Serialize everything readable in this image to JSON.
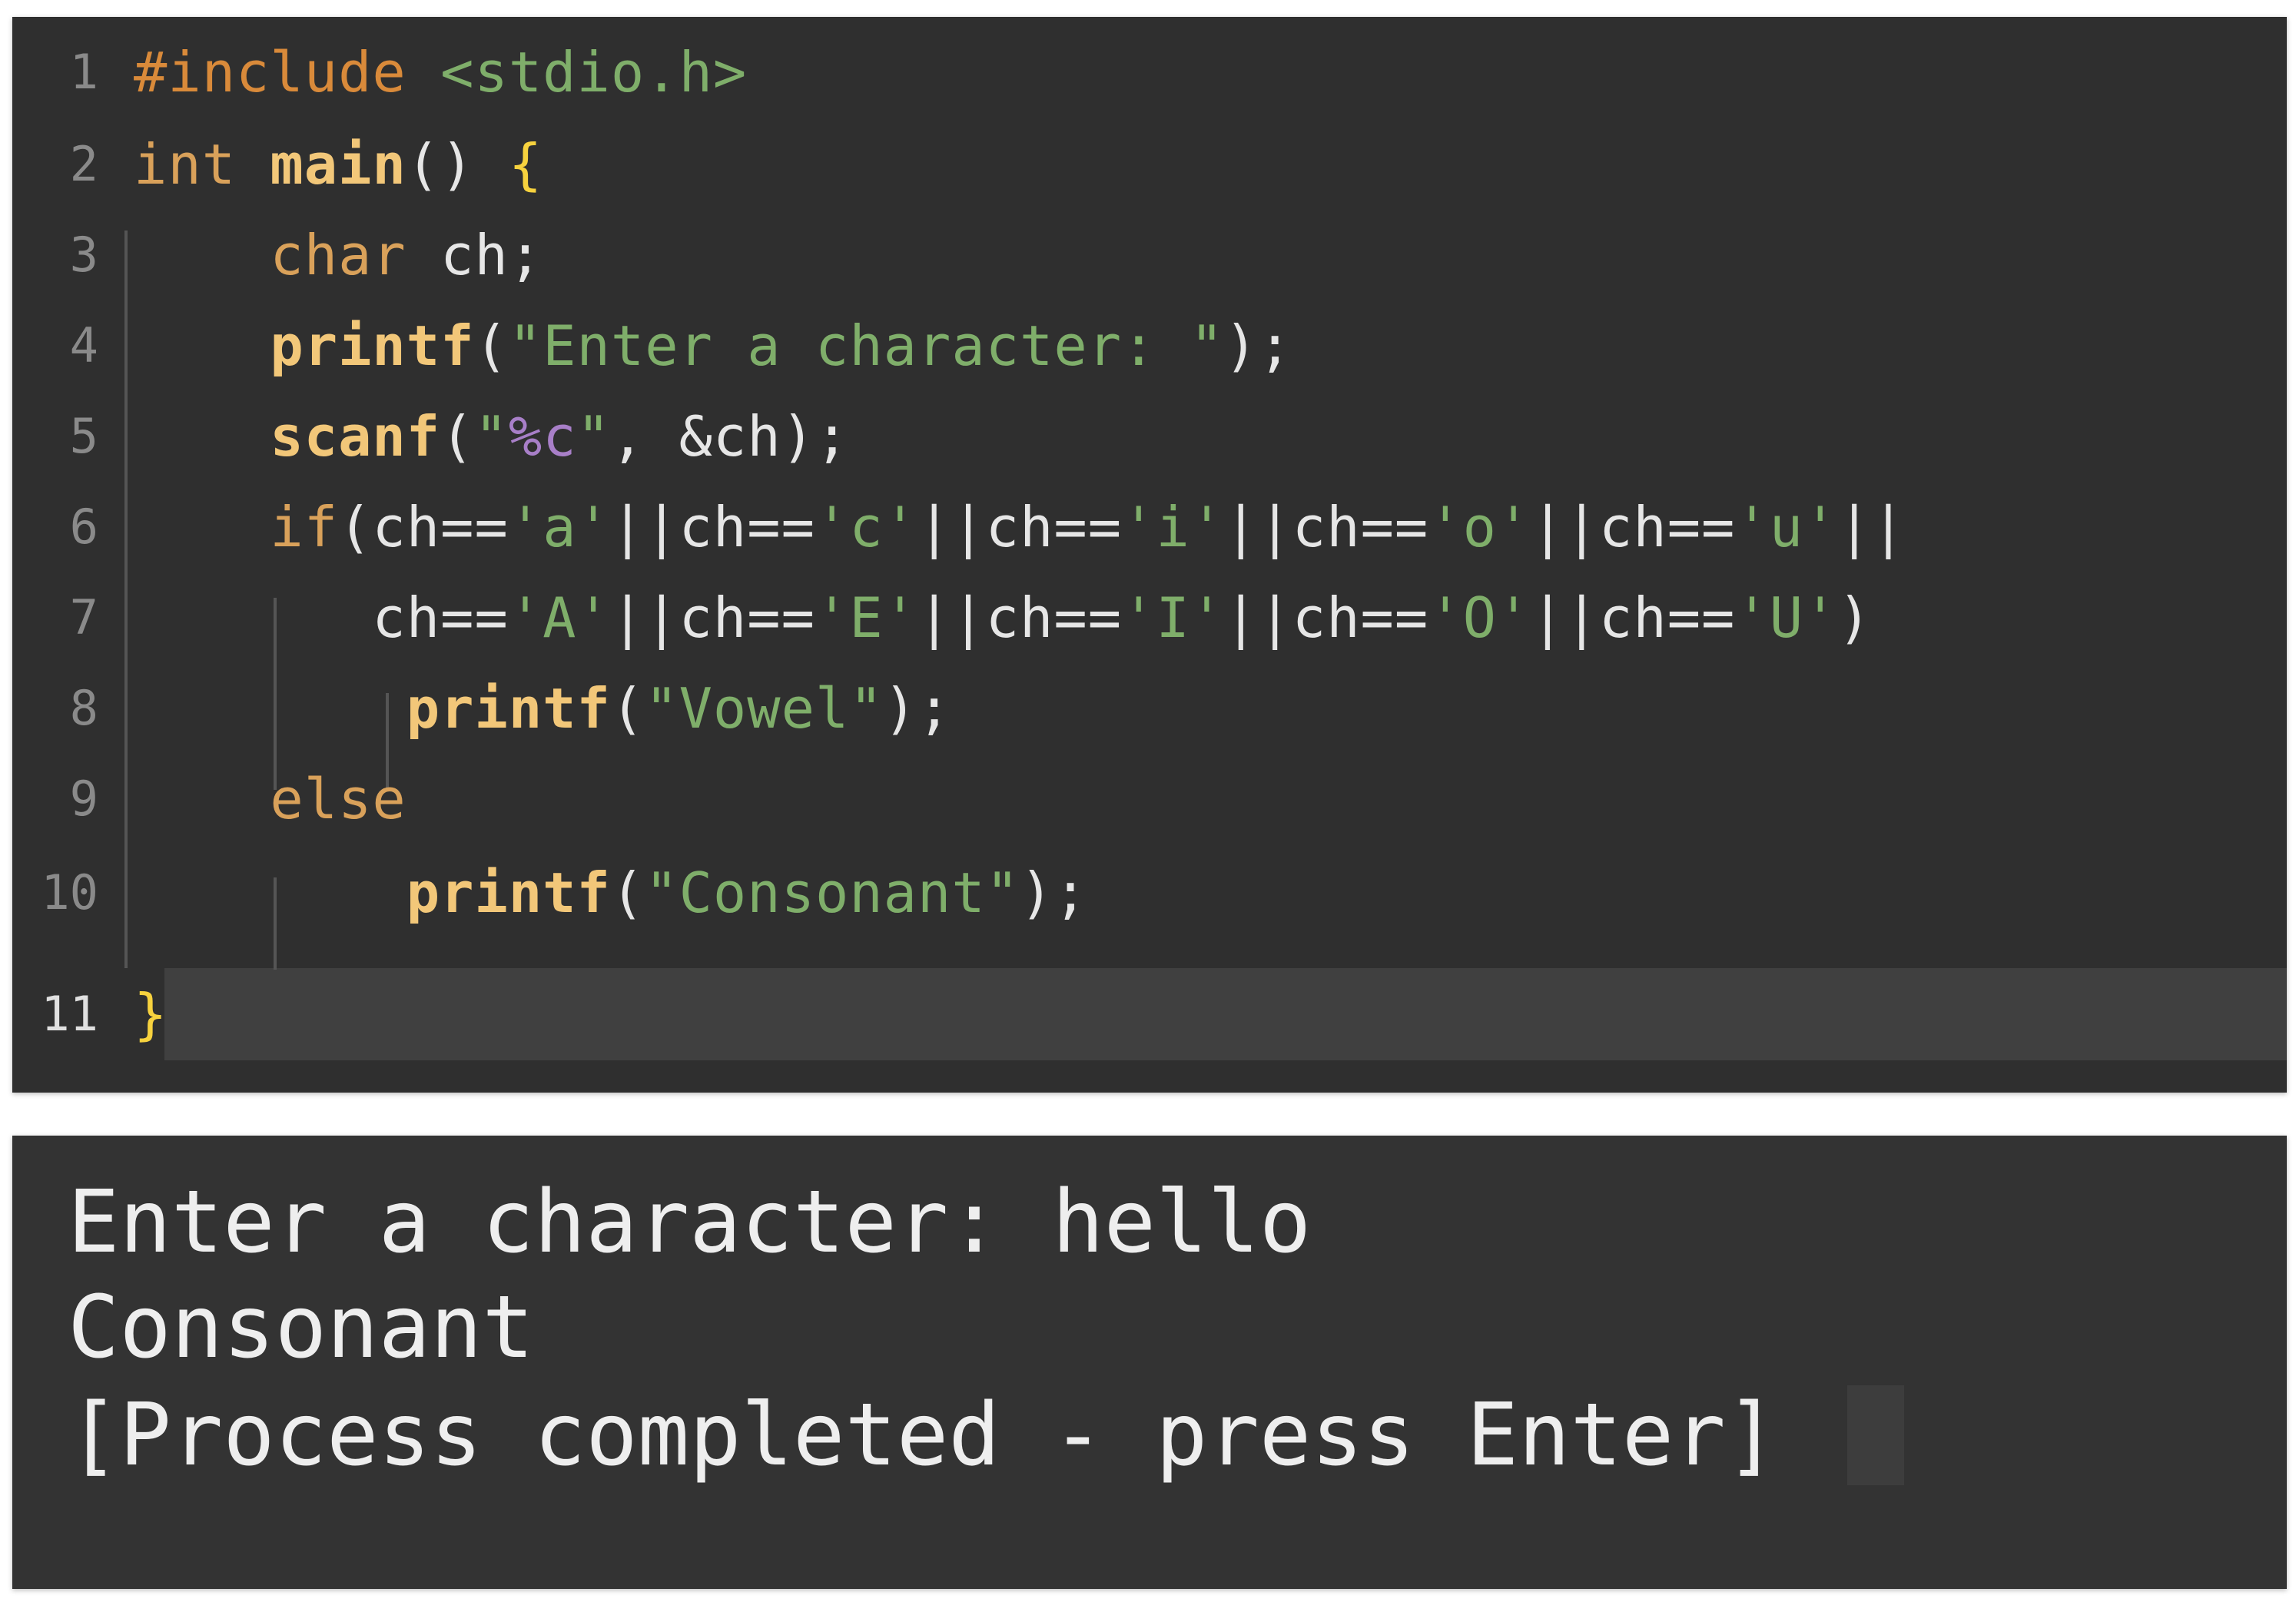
{
  "editor": {
    "line_numbers": [
      "1",
      "2",
      "3",
      "4",
      "5",
      "6",
      "7",
      "8",
      "9",
      "10",
      "11"
    ],
    "lines": [
      [
        {
          "t": "#include",
          "c": "pp"
        },
        {
          "t": " ",
          "c": "plain"
        },
        {
          "t": "<stdio.h>",
          "c": "hdr"
        }
      ],
      [
        {
          "t": "int",
          "c": "kw"
        },
        {
          "t": " ",
          "c": "plain"
        },
        {
          "t": "main",
          "c": "fn"
        },
        {
          "t": "() ",
          "c": "plain"
        },
        {
          "t": "{",
          "c": "brace"
        }
      ],
      [
        {
          "t": "    ",
          "c": "plain"
        },
        {
          "t": "char",
          "c": "kw"
        },
        {
          "t": " ch;",
          "c": "plain"
        }
      ],
      [
        {
          "t": "    ",
          "c": "plain"
        },
        {
          "t": "printf",
          "c": "fn"
        },
        {
          "t": "(",
          "c": "plain"
        },
        {
          "t": "\"Enter a character: \"",
          "c": "str"
        },
        {
          "t": ");",
          "c": "plain"
        }
      ],
      [
        {
          "t": "    ",
          "c": "plain"
        },
        {
          "t": "scanf",
          "c": "fn"
        },
        {
          "t": "(",
          "c": "plain"
        },
        {
          "t": "\"",
          "c": "str"
        },
        {
          "t": "%c",
          "c": "fmt"
        },
        {
          "t": "\"",
          "c": "str"
        },
        {
          "t": ", &ch);",
          "c": "plain"
        }
      ],
      [
        {
          "t": "    ",
          "c": "plain"
        },
        {
          "t": "if",
          "c": "kw"
        },
        {
          "t": "(ch==",
          "c": "plain"
        },
        {
          "t": "'a'",
          "c": "str"
        },
        {
          "t": "||ch==",
          "c": "plain"
        },
        {
          "t": "'c'",
          "c": "str"
        },
        {
          "t": "||ch==",
          "c": "plain"
        },
        {
          "t": "'i'",
          "c": "str"
        },
        {
          "t": "||ch==",
          "c": "plain"
        },
        {
          "t": "'o'",
          "c": "str"
        },
        {
          "t": "||ch==",
          "c": "plain"
        },
        {
          "t": "'u'",
          "c": "str"
        },
        {
          "t": "||",
          "c": "plain"
        }
      ],
      [
        {
          "t": "       ch==",
          "c": "plain"
        },
        {
          "t": "'A'",
          "c": "str"
        },
        {
          "t": "||ch==",
          "c": "plain"
        },
        {
          "t": "'E'",
          "c": "str"
        },
        {
          "t": "||ch==",
          "c": "plain"
        },
        {
          "t": "'I'",
          "c": "str"
        },
        {
          "t": "||ch==",
          "c": "plain"
        },
        {
          "t": "'O'",
          "c": "str"
        },
        {
          "t": "||ch==",
          "c": "plain"
        },
        {
          "t": "'U'",
          "c": "str"
        },
        {
          "t": ")",
          "c": "plain"
        }
      ],
      [
        {
          "t": "        ",
          "c": "plain"
        },
        {
          "t": "printf",
          "c": "fn"
        },
        {
          "t": "(",
          "c": "plain"
        },
        {
          "t": "\"Vowel\"",
          "c": "str"
        },
        {
          "t": ");",
          "c": "plain"
        }
      ],
      [
        {
          "t": "    ",
          "c": "plain"
        },
        {
          "t": "else",
          "c": "kw"
        }
      ],
      [
        {
          "t": "        ",
          "c": "plain"
        },
        {
          "t": "printf",
          "c": "fn"
        },
        {
          "t": "(",
          "c": "plain"
        },
        {
          "t": "\"Consonant\"",
          "c": "str"
        },
        {
          "t": ");",
          "c": "plain"
        }
      ],
      [
        {
          "t": "}",
          "c": "brace"
        }
      ]
    ],
    "active_line": 11
  },
  "terminal": {
    "lines": [
      "Enter a character: hello",
      "Consonant",
      "[Process completed - press Enter]"
    ]
  },
  "colors": {
    "editor_bg": "#2f2f2f",
    "terminal_bg": "#333333",
    "keyword": "#d9a15a",
    "function": "#f2c779",
    "string": "#7fae6a",
    "format_specifier": "#a87fc8",
    "brace": "#f7d23e"
  }
}
